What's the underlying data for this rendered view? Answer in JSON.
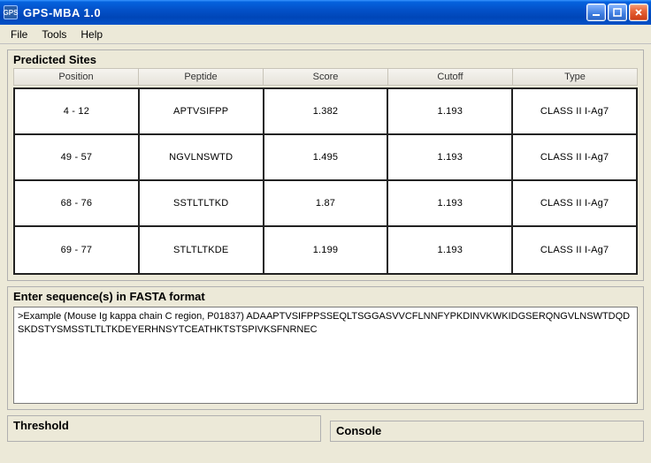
{
  "window": {
    "title": "GPS-MBA 1.0",
    "icon_label": "GPS"
  },
  "menubar": {
    "items": [
      "File",
      "Tools",
      "Help"
    ]
  },
  "predicted_sites": {
    "title": "Predicted Sites",
    "columns": [
      "Position",
      "Peptide",
      "Score",
      "Cutoff",
      "Type"
    ],
    "rows": [
      {
        "position": "4 - 12",
        "peptide": "APTVSIFPP",
        "score": "1.382",
        "cutoff": "1.193",
        "type": "CLASS II I-Ag7"
      },
      {
        "position": "49 - 57",
        "peptide": "NGVLNSWTD",
        "score": "1.495",
        "cutoff": "1.193",
        "type": "CLASS II I-Ag7"
      },
      {
        "position": "68 - 76",
        "peptide": "SSTLTLTKD",
        "score": "1.87",
        "cutoff": "1.193",
        "type": "CLASS II I-Ag7"
      },
      {
        "position": "69 - 77",
        "peptide": "STLTLTKDE",
        "score": "1.199",
        "cutoff": "1.193",
        "type": "CLASS II I-Ag7"
      }
    ]
  },
  "fasta": {
    "title": "Enter sequence(s) in FASTA format",
    "value": ">Example (Mouse Ig kappa chain C region, P01837)\nADAAPTVSIFPPSSEQLTSGGASVVCFLNNFYPKDINVKWKIDGSERQNGVLNSWTDQDSKDSTYSMSSTLTLTKDEYERHNSYTCEATHKTSTSPIVKSFNRNEC"
  },
  "threshold": {
    "title": "Threshold"
  },
  "console": {
    "title": "Console"
  }
}
